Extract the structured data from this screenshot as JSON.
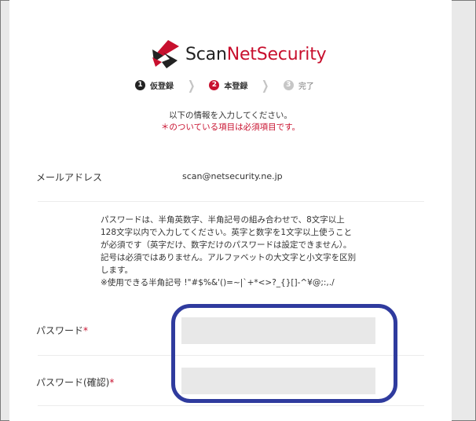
{
  "brand": {
    "name_scan": "Scan",
    "name_net": "NetSecurity"
  },
  "steps": [
    {
      "num": "1",
      "label": "仮登録"
    },
    {
      "num": "2",
      "label": "本登録"
    },
    {
      "num": "3",
      "label": "完了"
    }
  ],
  "intro": {
    "line1": "以下の情報を入力してください。",
    "line2": "＊のついている項目は必須項目です。"
  },
  "email": {
    "label": "メールアドレス",
    "value": "scan@netsecurity.ne.jp"
  },
  "password_note": [
    "パスワードは、半角英数字、半角記号の組み合わせで、8文字以上",
    "128文字以内で入力してください。英字と数字を1文字以上使うこと",
    "が必須です（英字だけ、数字だけのパスワードは設定できません）。",
    "記号は必須ではありません。アルファベットの大文字と小文字を区別",
    "します。",
    "※使用できる半角記号 !\"#$%&'()=~|`+*<>?_{}[]-^¥@;:,./"
  ],
  "password": {
    "label": "パスワード",
    "required_mark": "*",
    "value": ""
  },
  "password_confirm": {
    "label": "パスワード(確認)",
    "required_mark": "*",
    "value": ""
  },
  "colors": {
    "brand_red": "#c8102e",
    "highlight_blue": "#2f3b9e"
  }
}
